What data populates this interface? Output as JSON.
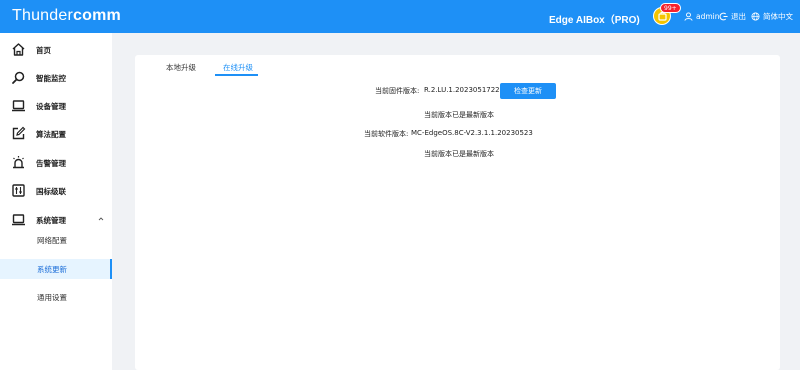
{
  "header": {
    "brand_light": "Thunder",
    "brand_bold": "comm",
    "device_title": "Edge AIBox（PRO)",
    "notification_badge": "99+",
    "user": "admin",
    "logout": "退出",
    "language": "简体中文"
  },
  "sidebar": {
    "items": [
      {
        "label": "首页",
        "icon": "home-icon"
      },
      {
        "label": "智能监控",
        "icon": "search-icon"
      },
      {
        "label": "设备管理",
        "icon": "laptop-icon"
      },
      {
        "label": "算法配置",
        "icon": "edit-icon"
      },
      {
        "label": "告警管理",
        "icon": "alarm-icon"
      },
      {
        "label": "国标级联",
        "icon": "sliders-icon"
      },
      {
        "label": "系统管理",
        "icon": "laptop-icon"
      }
    ],
    "submenu": [
      {
        "label": "网络配置"
      },
      {
        "label": "系统更新"
      },
      {
        "label": "通用设置"
      }
    ]
  },
  "tabs": [
    {
      "label": "本地升级"
    },
    {
      "label": "在线升级"
    }
  ],
  "firmware": {
    "label": "当前固件版本:",
    "value": "R.2.LU.1.202305172225",
    "check_button": "检查更新",
    "status": "当前版本已是最新版本"
  },
  "software": {
    "label": "当前软件版本:",
    "value": "MC-EdgeOS.8C-V2.3.1.1.20230523",
    "status": "当前版本已是最新版本"
  },
  "colors": {
    "primary": "#1e90f6",
    "badge": "#f5222d",
    "bell": "#f5c400"
  }
}
